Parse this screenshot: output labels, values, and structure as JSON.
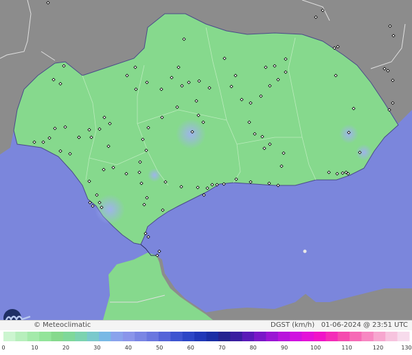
{
  "map": {
    "colors": {
      "sea": "#7b86dc",
      "land_outside": "#8a8a8a",
      "region_fill": "#86d98d",
      "region_light": "#9ee3a3",
      "coast_dark": "#3f3f7a",
      "borders": "#e8e8e8",
      "highlight_blue": "#8fa8ea"
    },
    "stations_marker": "small white dot with black outline"
  },
  "credit": {
    "text": "© Meteoclimatic",
    "caption": "DGST (km/h)   01-06-2024 @ 23:51 UTC",
    "logo_icon": "meteoclimatic-logo-icon"
  },
  "legend": {
    "ticks": [
      "0",
      "10",
      "20",
      "30",
      "40",
      "50",
      "60",
      "70",
      "80",
      "90",
      "100",
      "110",
      "120",
      "130"
    ],
    "colors": [
      "#ccf5d0",
      "#b7efbc",
      "#a4eaaa",
      "#93e49a",
      "#86d98d",
      "#7fd89a",
      "#7cd3b0",
      "#7ac9cc",
      "#79b9e5",
      "#8aa3ec",
      "#8a95ea",
      "#7a86e4",
      "#6a77df",
      "#5564d8",
      "#3e55d0",
      "#2c46c6",
      "#2038b8",
      "#1a2ea5",
      "#242390",
      "#3a1ea0",
      "#5a1ab8",
      "#7a18c8",
      "#9a16d4",
      "#b814dc",
      "#d012e0",
      "#e312d8",
      "#f014c8",
      "#f42cb8",
      "#f54aaf",
      "#f66ab6",
      "#f788c2",
      "#f7a6cf",
      "#f7c3de",
      "#f7dbec"
    ]
  }
}
